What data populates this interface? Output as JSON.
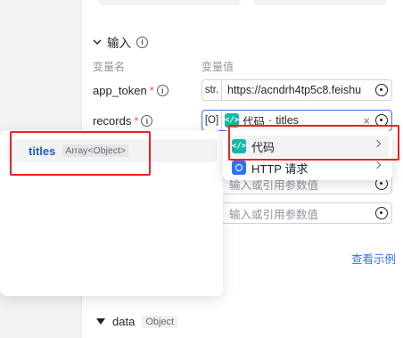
{
  "section": {
    "title": "输入"
  },
  "columns": {
    "name": "变量名",
    "value": "变量值"
  },
  "params": [
    {
      "name": "app_token",
      "type": "str.",
      "value": "https://acndrh4tp5c8.feishu"
    },
    {
      "name": "records",
      "type": "[O]",
      "ref_source": "代码",
      "ref_field": "titles"
    }
  ],
  "placeholders": {
    "row3": "输入或引用参数值",
    "row4": "输入或引用参数值"
  },
  "links": {
    "examples": "查看示例"
  },
  "output": {
    "name": "data",
    "type": "Object"
  },
  "variable_popup": {
    "items": [
      {
        "name": "titles",
        "type": "Array<Object>"
      }
    ]
  },
  "source_menu": {
    "items": [
      {
        "label": "代码",
        "icon": "code-icon",
        "color": "#14b8a6"
      },
      {
        "label": "HTTP 请求",
        "icon": "http-request-icon",
        "color": "#3370ff"
      }
    ]
  },
  "highlight_color": "#e8231f"
}
